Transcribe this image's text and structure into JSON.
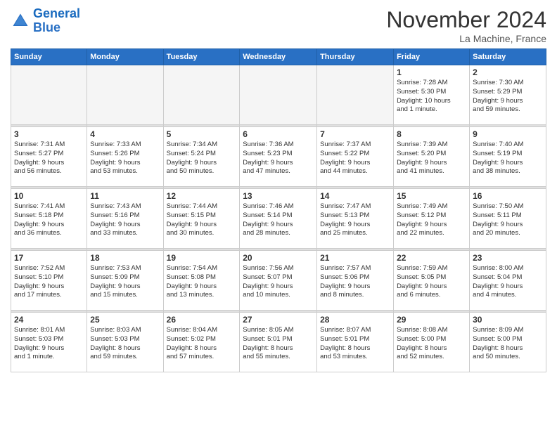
{
  "header": {
    "logo_line1": "General",
    "logo_line2": "Blue",
    "month": "November 2024",
    "location": "La Machine, France"
  },
  "weekdays": [
    "Sunday",
    "Monday",
    "Tuesday",
    "Wednesday",
    "Thursday",
    "Friday",
    "Saturday"
  ],
  "weeks": [
    [
      {
        "day": "",
        "info": ""
      },
      {
        "day": "",
        "info": ""
      },
      {
        "day": "",
        "info": ""
      },
      {
        "day": "",
        "info": ""
      },
      {
        "day": "",
        "info": ""
      },
      {
        "day": "1",
        "info": "Sunrise: 7:28 AM\nSunset: 5:30 PM\nDaylight: 10 hours\nand 1 minute."
      },
      {
        "day": "2",
        "info": "Sunrise: 7:30 AM\nSunset: 5:29 PM\nDaylight: 9 hours\nand 59 minutes."
      }
    ],
    [
      {
        "day": "3",
        "info": "Sunrise: 7:31 AM\nSunset: 5:27 PM\nDaylight: 9 hours\nand 56 minutes."
      },
      {
        "day": "4",
        "info": "Sunrise: 7:33 AM\nSunset: 5:26 PM\nDaylight: 9 hours\nand 53 minutes."
      },
      {
        "day": "5",
        "info": "Sunrise: 7:34 AM\nSunset: 5:24 PM\nDaylight: 9 hours\nand 50 minutes."
      },
      {
        "day": "6",
        "info": "Sunrise: 7:36 AM\nSunset: 5:23 PM\nDaylight: 9 hours\nand 47 minutes."
      },
      {
        "day": "7",
        "info": "Sunrise: 7:37 AM\nSunset: 5:22 PM\nDaylight: 9 hours\nand 44 minutes."
      },
      {
        "day": "8",
        "info": "Sunrise: 7:39 AM\nSunset: 5:20 PM\nDaylight: 9 hours\nand 41 minutes."
      },
      {
        "day": "9",
        "info": "Sunrise: 7:40 AM\nSunset: 5:19 PM\nDaylight: 9 hours\nand 38 minutes."
      }
    ],
    [
      {
        "day": "10",
        "info": "Sunrise: 7:41 AM\nSunset: 5:18 PM\nDaylight: 9 hours\nand 36 minutes."
      },
      {
        "day": "11",
        "info": "Sunrise: 7:43 AM\nSunset: 5:16 PM\nDaylight: 9 hours\nand 33 minutes."
      },
      {
        "day": "12",
        "info": "Sunrise: 7:44 AM\nSunset: 5:15 PM\nDaylight: 9 hours\nand 30 minutes."
      },
      {
        "day": "13",
        "info": "Sunrise: 7:46 AM\nSunset: 5:14 PM\nDaylight: 9 hours\nand 28 minutes."
      },
      {
        "day": "14",
        "info": "Sunrise: 7:47 AM\nSunset: 5:13 PM\nDaylight: 9 hours\nand 25 minutes."
      },
      {
        "day": "15",
        "info": "Sunrise: 7:49 AM\nSunset: 5:12 PM\nDaylight: 9 hours\nand 22 minutes."
      },
      {
        "day": "16",
        "info": "Sunrise: 7:50 AM\nSunset: 5:11 PM\nDaylight: 9 hours\nand 20 minutes."
      }
    ],
    [
      {
        "day": "17",
        "info": "Sunrise: 7:52 AM\nSunset: 5:10 PM\nDaylight: 9 hours\nand 17 minutes."
      },
      {
        "day": "18",
        "info": "Sunrise: 7:53 AM\nSunset: 5:09 PM\nDaylight: 9 hours\nand 15 minutes."
      },
      {
        "day": "19",
        "info": "Sunrise: 7:54 AM\nSunset: 5:08 PM\nDaylight: 9 hours\nand 13 minutes."
      },
      {
        "day": "20",
        "info": "Sunrise: 7:56 AM\nSunset: 5:07 PM\nDaylight: 9 hours\nand 10 minutes."
      },
      {
        "day": "21",
        "info": "Sunrise: 7:57 AM\nSunset: 5:06 PM\nDaylight: 9 hours\nand 8 minutes."
      },
      {
        "day": "22",
        "info": "Sunrise: 7:59 AM\nSunset: 5:05 PM\nDaylight: 9 hours\nand 6 minutes."
      },
      {
        "day": "23",
        "info": "Sunrise: 8:00 AM\nSunset: 5:04 PM\nDaylight: 9 hours\nand 4 minutes."
      }
    ],
    [
      {
        "day": "24",
        "info": "Sunrise: 8:01 AM\nSunset: 5:03 PM\nDaylight: 9 hours\nand 1 minute."
      },
      {
        "day": "25",
        "info": "Sunrise: 8:03 AM\nSunset: 5:03 PM\nDaylight: 8 hours\nand 59 minutes."
      },
      {
        "day": "26",
        "info": "Sunrise: 8:04 AM\nSunset: 5:02 PM\nDaylight: 8 hours\nand 57 minutes."
      },
      {
        "day": "27",
        "info": "Sunrise: 8:05 AM\nSunset: 5:01 PM\nDaylight: 8 hours\nand 55 minutes."
      },
      {
        "day": "28",
        "info": "Sunrise: 8:07 AM\nSunset: 5:01 PM\nDaylight: 8 hours\nand 53 minutes."
      },
      {
        "day": "29",
        "info": "Sunrise: 8:08 AM\nSunset: 5:00 PM\nDaylight: 8 hours\nand 52 minutes."
      },
      {
        "day": "30",
        "info": "Sunrise: 8:09 AM\nSunset: 5:00 PM\nDaylight: 8 hours\nand 50 minutes."
      }
    ]
  ]
}
